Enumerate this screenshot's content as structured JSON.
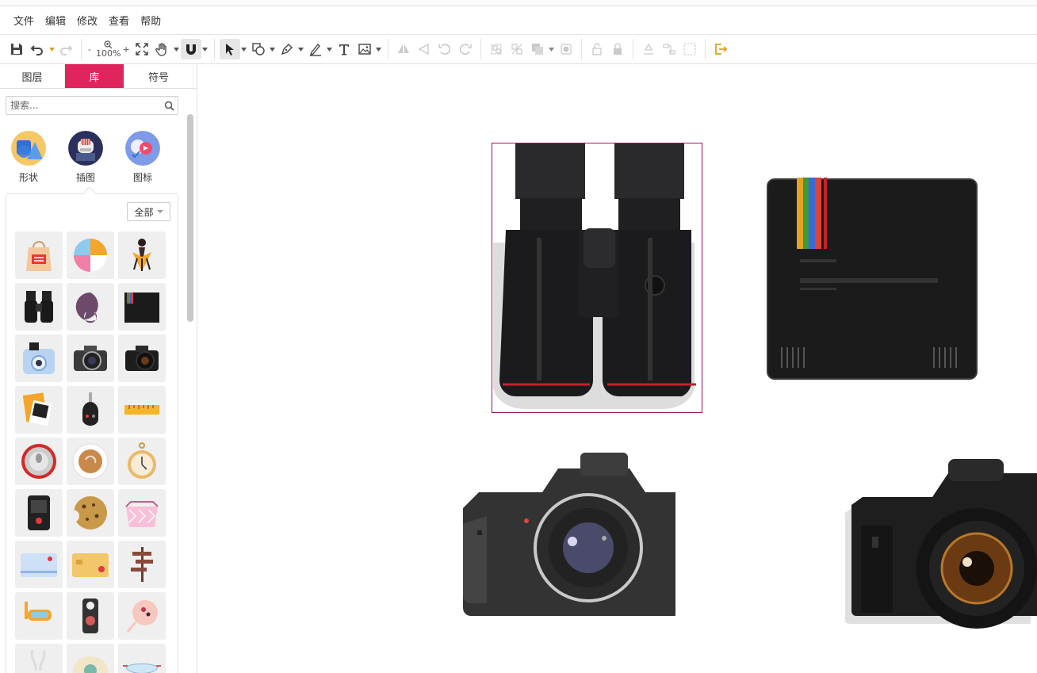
{
  "menubar": {
    "items": [
      "文件",
      "编辑",
      "修改",
      "查看",
      "帮助"
    ]
  },
  "toolbar": {
    "zoom_minus": "-",
    "zoom_value": "100%",
    "zoom_plus": "+",
    "icons": [
      "save-icon",
      "undo-icon",
      "redo-icon",
      "zoom-icon",
      "fit-icon",
      "hand-icon",
      "magnet-icon",
      "pointer-icon",
      "shape-icon",
      "pen-icon",
      "pencil-icon",
      "text-icon",
      "image-icon",
      "flip-horizontal-icon",
      "flip-vertical-icon",
      "rotate-left-icon",
      "rotate-right-icon",
      "group-icon",
      "ungroup-icon",
      "arrange-icon",
      "opacity-icon",
      "lock-icon",
      "unlock-icon",
      "recycle-icon",
      "connect-icon",
      "select-region-icon",
      "exit-icon"
    ],
    "accent": "#e0245e",
    "exit_color": "#e0a020"
  },
  "sidebar": {
    "tabs": [
      "图层",
      "库",
      "符号"
    ],
    "active_tab": "库",
    "search": {
      "placeholder": "搜索..."
    },
    "categories": [
      {
        "label": "形状",
        "icon": "shapes-category-icon"
      },
      {
        "label": "插图",
        "icon": "illustration-category-icon"
      },
      {
        "label": "图标",
        "icon": "icons-category-icon"
      }
    ],
    "filter": {
      "value": "全部"
    },
    "library_items": [
      "duty-free-bag",
      "beach-ball",
      "hula-figure",
      "binoculars",
      "neck-pillow",
      "instant-camera-black",
      "instant-camera-blue",
      "dslr-camera",
      "dslr-camera-dark",
      "photos",
      "car-key",
      "tape-measure",
      "can-top",
      "coffee-cup",
      "pocket-watch",
      "action-camera",
      "cookie",
      "cosmetic-bag",
      "credit-card-blue",
      "credit-card-gold",
      "signpost",
      "snorkel-mask",
      "door-hanger",
      "lollipop",
      "earphones",
      "plate",
      "sleep-mask"
    ]
  },
  "canvas": {
    "objects": [
      "binoculars",
      "instant-camera",
      "dslr-camera",
      "dslr-camera-2"
    ],
    "selected": "binoculars",
    "selection_color": "#a0125a"
  }
}
